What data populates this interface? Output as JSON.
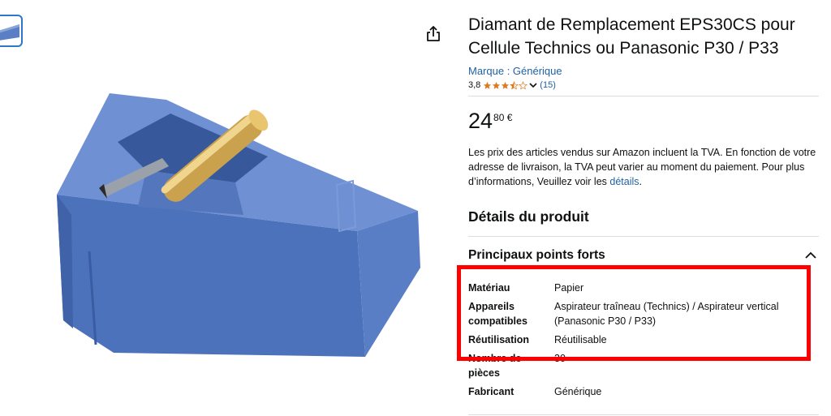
{
  "product": {
    "title": "Diamant de Remplacement EPS30CS pour Cellule Technics ou Panasonic P30 / P33",
    "brand_link": "Marque : Générique",
    "rating_value": "3,8",
    "rating": 3.8,
    "rating_max": 5,
    "rating_count": "(15)",
    "price_whole": "24",
    "price_fraction": "80 €"
  },
  "vat": {
    "text": "Les prix des articles vendus sur Amazon incluent la TVA. En fonction de votre adresse de livraison, la TVA peut varier au moment du paiement. Pour plus d’informations, Veuillez voir les ",
    "link": "détails",
    "end": "."
  },
  "details": {
    "heading": "Détails du produit",
    "section_title": "Principaux points forts",
    "specs": [
      {
        "label": "Matériau",
        "value": "Papier"
      },
      {
        "label": "Appareils compatibles",
        "value": "Aspirateur traîneau (Technics) / Aspirateur vertical (Panasonic P30 / P33)"
      },
      {
        "label": "Réutilisation",
        "value": "Réutilisable"
      },
      {
        "label": "Nombre de pièces",
        "value": "30"
      },
      {
        "label": "Fabricant",
        "value": "Générique"
      }
    ]
  },
  "icons": {
    "share": "share-icon",
    "collapse": "chevron-up-icon",
    "rating_dropdown": "chevron-down-icon"
  },
  "colors": {
    "link": "#2162a1",
    "star": "#de7921",
    "highlight": "#ff0000",
    "thumb_border": "#2e76c6",
    "product_blue": "#5b7fc4"
  }
}
